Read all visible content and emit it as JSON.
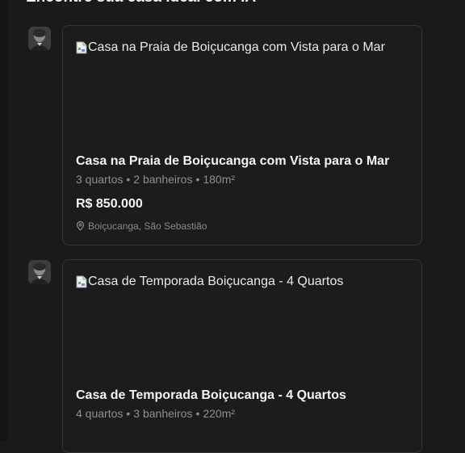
{
  "page": {
    "title": "Encontre sua casa ideal com IA"
  },
  "listings": [
    {
      "image_alt": "Casa na Praia de Boiçucanga com Vista para o Mar",
      "title": "Casa na Praia de Boiçucanga com Vista para o Mar",
      "bedrooms": "3 quartos",
      "bathrooms": "2 banheiros",
      "area": "180m²",
      "price": "R$ 850.000",
      "location": "Boiçucanga, São Sebastião"
    },
    {
      "image_alt": "Casa de Temporada Boiçucanga - 4 Quartos",
      "title": "Casa de Temporada Boiçucanga - 4 Quartos",
      "bedrooms": "4 quartos",
      "bathrooms": "3 banheiros",
      "area": "220m²"
    }
  ],
  "separator": "•",
  "icons": {
    "avatar": "agent-avatar",
    "broken_image": "broken-image-icon",
    "location": "map-pin-icon"
  },
  "colors": {
    "background": "#1a1a1a",
    "card_border": "#343434",
    "muted_text": "#8f8f8f"
  }
}
